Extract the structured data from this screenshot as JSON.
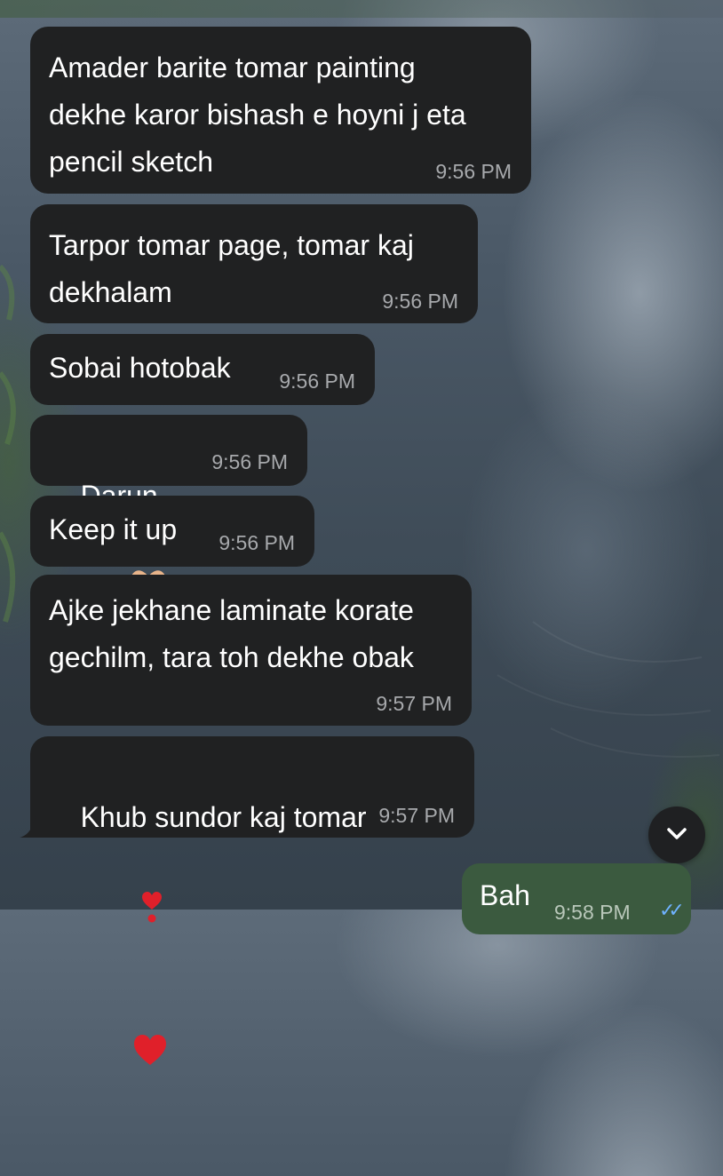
{
  "messages": [
    {
      "text": "Amader barite tomar painting\ndekhe karor bishash e hoyni j eta\npencil sketch",
      "time": "9:56 PM"
    },
    {
      "text": "Tarpor tomar page, tomar kaj\ndekhalam",
      "time": "9:56 PM"
    },
    {
      "text": "Sobai hotobak",
      "time": "9:56 PM"
    },
    {
      "text": "Darun",
      "emoji": "heart-hands-emoji",
      "time": "9:56 PM"
    },
    {
      "text": "Keep it up",
      "time": "9:56 PM"
    },
    {
      "text": "Ajke jekhane laminate korate\ngechilm, tara toh dekhe obak",
      "time": "9:57 PM"
    },
    {
      "text": "Khub sundor kaj tomar",
      "emoji": "exclamation-heart-emoji red-heart-emoji",
      "time": "9:57 PM"
    }
  ],
  "outgoing": {
    "text": "Bah",
    "time": "9:58 PM",
    "status": "read-checkmarks-icon"
  },
  "scroll_button": {
    "icon": "chevron-down-icon"
  },
  "colors": {
    "incoming_bubble": "#202122",
    "outgoing_bubble": "#3b5a3f",
    "timestamp": "#a7a9ac",
    "read_check": "#6fb2ff"
  }
}
